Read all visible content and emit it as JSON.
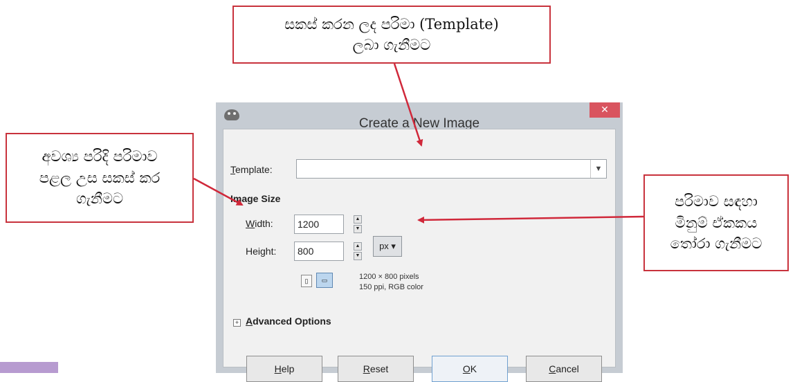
{
  "callouts": {
    "top": {
      "line1": "සකස් කරන ලද පරිමා (Template)",
      "line2": "ලබා ගැනීමට"
    },
    "left": {
      "line1": "අවශ්‍ය පරිදි පරිමාව",
      "line2": "පළල උස සකස් කර",
      "line3": "ගැනීමට"
    },
    "right": {
      "line1": "පරිමාව සඳහා",
      "line2": "මිනුම් ඒකකය",
      "line3": "තෝරා ගැනීමට"
    }
  },
  "dialog": {
    "title": "Create a New Image",
    "close_glyph": "✕",
    "template_label": "Template:",
    "template_value": "",
    "image_size_heading": "Image Size",
    "width_label": "Width:",
    "width_value": "1200",
    "height_label": "Height:",
    "height_value": "800",
    "unit": "px ▾",
    "info_size": "1200 × 800 pixels",
    "info_res": "150 ppi, RGB color",
    "advanced_label": "Advanced Options",
    "buttons": {
      "help": "Help",
      "reset": "Reset",
      "ok": "OK",
      "cancel": "Cancel"
    }
  },
  "colors": {
    "callout_border": "#c8323c",
    "arrow": "#d0283a",
    "dialog_bg": "#c6ccd3",
    "close": "#d9545f"
  },
  "icons": [
    "app-icon",
    "close-icon",
    "dropdown-arrow-icon",
    "spin-up-icon",
    "spin-down-icon",
    "portrait-icon",
    "landscape-icon",
    "expand-icon"
  ]
}
